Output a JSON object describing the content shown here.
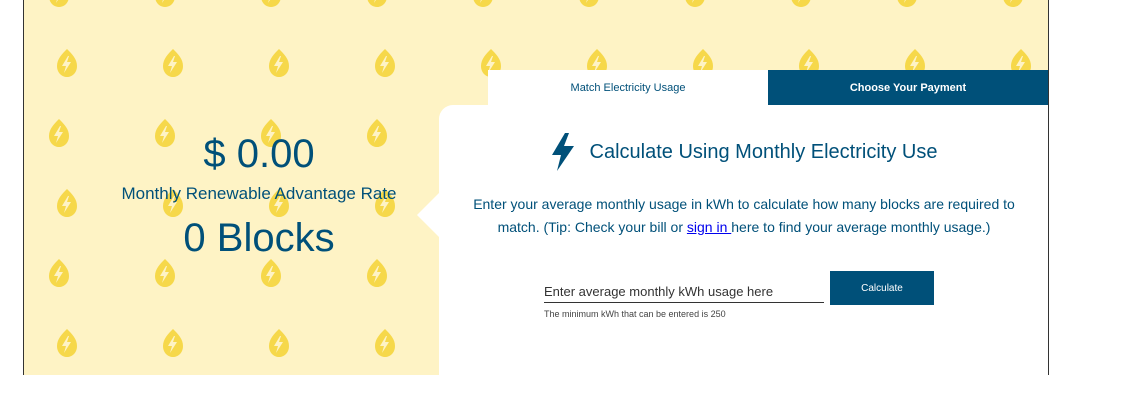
{
  "summary": {
    "amount": "$ 0.00",
    "rate_label": "Monthly Renewable Advantage Rate",
    "blocks": "0 Blocks"
  },
  "tabs": [
    {
      "label": "Match Electricity Usage",
      "active": true
    },
    {
      "label": "Choose Your Payment",
      "active": false
    }
  ],
  "card": {
    "title": "Calculate Using Monthly Electricity Use",
    "description_before": "Enter your average monthly usage in kWh to calculate how many blocks are required to match. (Tip: Check your bill or ",
    "sign_in_link": "sign in ",
    "description_after": "here to find your average monthly usage.)",
    "input_placeholder": "Enter average monthly kWh usage here",
    "input_value": "",
    "hint": "The minimum kWh that can be entered is 250",
    "button_label": "Calculate"
  },
  "colors": {
    "brand": "#005079",
    "background_pattern": "#fef3c5",
    "bolt_pattern": "#f6d84a",
    "link": "#0000ee"
  },
  "icons": {
    "title_icon": "lightning-bolt-icon",
    "pattern_icon": "leaf-bolt-icon"
  }
}
